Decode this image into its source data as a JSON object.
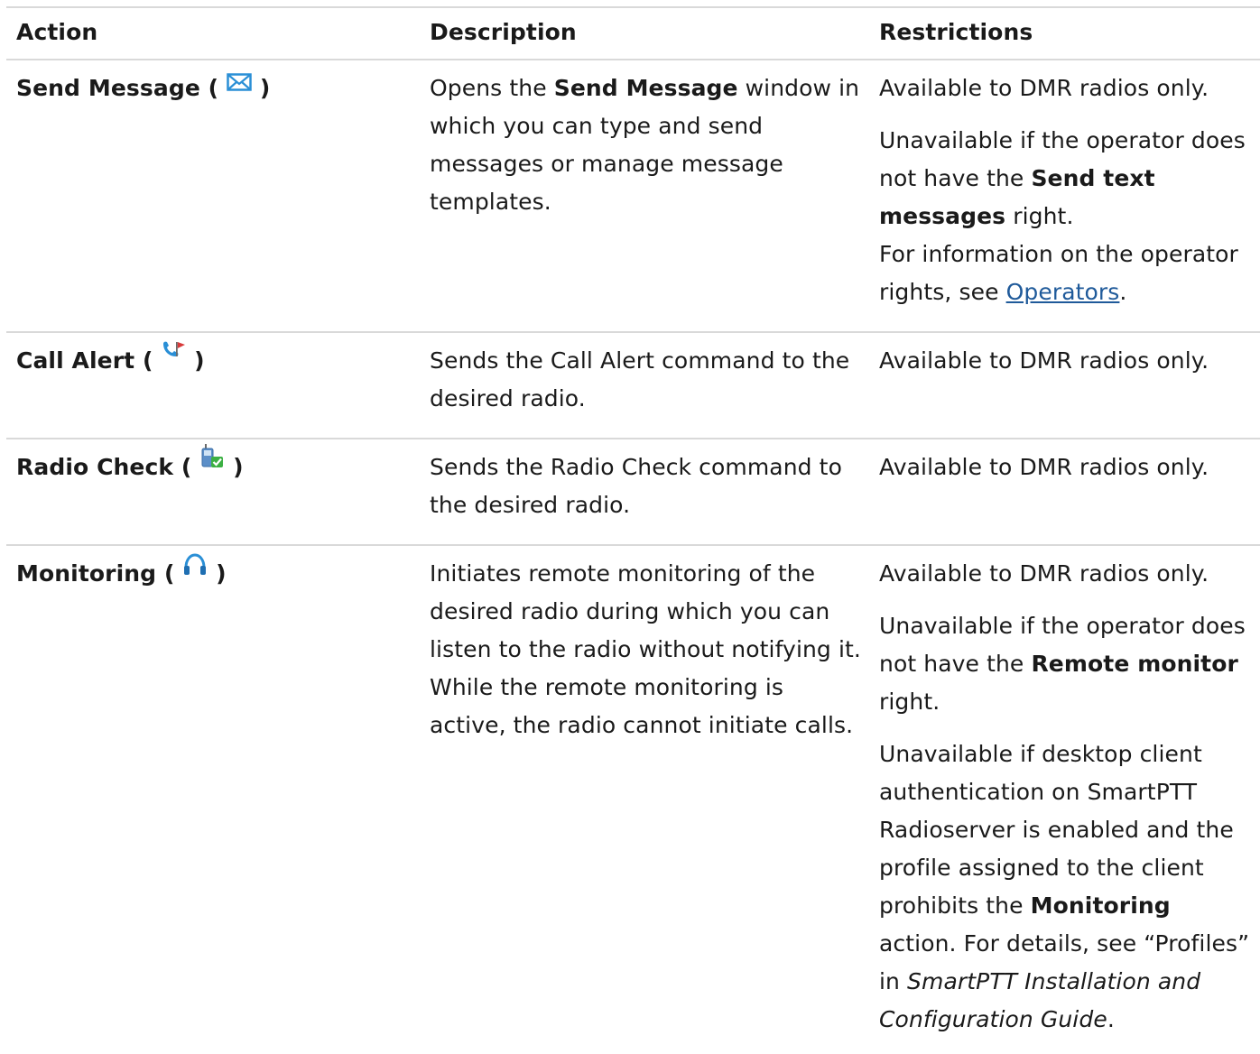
{
  "header": {
    "action": "Action",
    "description": "Description",
    "restrictions": "Restrictions"
  },
  "rows": [
    {
      "action": "Send Message",
      "icon": "envelope-icon",
      "description": {
        "pre": "Opens the ",
        "bold": "Send Message",
        "post": " window in which you can type and send messages or manage message templates."
      },
      "restrictions": {
        "p1": "Available to DMR radios only.",
        "p2_pre": "Unavailable if the operator does not have the ",
        "p2_bold": "Send text messages",
        "p2_post": " right.",
        "p3_pre": "For information on the operator rights, see ",
        "p3_link": "Operators",
        "p3_post": "."
      }
    },
    {
      "action": "Call Alert",
      "icon": "call-alert-icon",
      "description": "Sends the Call Alert command to the desired radio.",
      "restrictions": "Available to DMR radios only."
    },
    {
      "action": "Radio Check",
      "icon": "radio-check-icon",
      "description": "Sends the Radio Check command to the desired radio.",
      "restrictions": "Available to DMR radios only."
    },
    {
      "action": "Monitoring",
      "icon": "headphones-icon",
      "description": "Initiates remote monitoring of the desired radio during which you can listen to the radio without notifying it. While the remote monitoring is active, the radio cannot initiate calls.",
      "restrictions": {
        "p1": "Available to DMR radios only.",
        "p2_pre": "Unavailable if the operator does not have the ",
        "p2_bold": "Remote monitor",
        "p2_post": " right.",
        "p3_pre": "Unavailable if desktop client authentication on SmartPTT Radioserver is enabled and the profile assigned to the client prohibits the ",
        "p3_bold": "Monitoring",
        "p3_post": " action. For details, see “Profiles” in ",
        "p3_italic": "SmartPTT Installation and Configuration Guide",
        "p3_end": "."
      }
    }
  ],
  "colors": {
    "border": "#d9d9d9",
    "link": "#1f5a9a",
    "icon_blue": "#2a8fd6",
    "icon_red": "#d83a3a",
    "icon_green": "#3cb043"
  },
  "punct": {
    "open": " ( ",
    "close": " )"
  }
}
